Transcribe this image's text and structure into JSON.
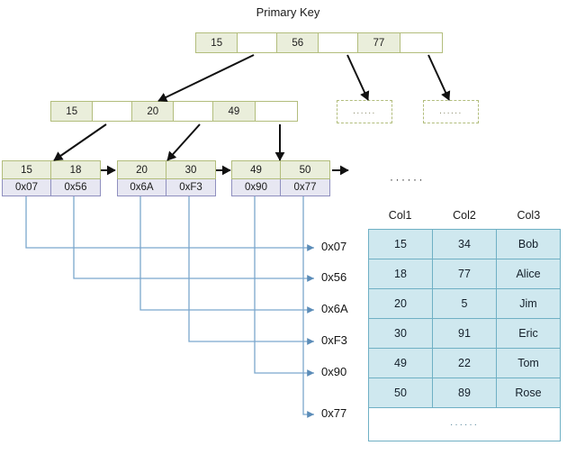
{
  "title": "Primary Key",
  "colors": {
    "index_node_fill": "#eaeedb",
    "index_node_border": "#b2bd7c",
    "pointer_row_fill": "#e7e7f2",
    "pointer_row_border": "#8f8fbf",
    "table_fill": "#cfe8ef",
    "table_border": "#6fb0c4",
    "connector_line": "#7ba7cd",
    "tree_arrow": "#111111"
  },
  "tree": {
    "root": {
      "name": "root-node",
      "cells": [
        {
          "label": "15",
          "empty": false
        },
        {
          "label": "",
          "empty": true
        },
        {
          "label": "56",
          "empty": false
        },
        {
          "label": "",
          "empty": true
        },
        {
          "label": "77",
          "empty": false
        },
        {
          "label": "",
          "empty": true
        }
      ]
    },
    "internal": {
      "name": "internal-node",
      "cells": [
        {
          "label": "15",
          "empty": false
        },
        {
          "label": "",
          "empty": true
        },
        {
          "label": "20",
          "empty": false
        },
        {
          "label": "",
          "empty": true
        },
        {
          "label": "49",
          "empty": false
        },
        {
          "label": "",
          "empty": true
        }
      ]
    },
    "leaves": [
      {
        "name": "leaf-node-1",
        "keys": [
          "15",
          "18"
        ],
        "pointers": [
          "0x07",
          "0x56"
        ]
      },
      {
        "name": "leaf-node-2",
        "keys": [
          "20",
          "30"
        ],
        "pointers": [
          "0x6A",
          "0xF3"
        ]
      },
      {
        "name": "leaf-node-3",
        "keys": [
          "49",
          "50"
        ],
        "pointers": [
          "0x90",
          "0x77"
        ]
      }
    ],
    "placeholders": [
      {
        "name": "placeholder-node-1",
        "label": "......"
      },
      {
        "name": "placeholder-node-2",
        "label": "......"
      }
    ]
  },
  "addresses": [
    {
      "label": "0x07"
    },
    {
      "label": "0x56"
    },
    {
      "label": "0x6A"
    },
    {
      "label": "0xF3"
    },
    {
      "label": "0x90"
    },
    {
      "label": "0x77"
    }
  ],
  "data_table": {
    "above_ellipsis": "······",
    "columns": [
      "Col1",
      "Col2",
      "Col3"
    ],
    "rows": [
      [
        "15",
        "34",
        "Bob"
      ],
      [
        "18",
        "77",
        "Alice"
      ],
      [
        "20",
        "5",
        "Jim"
      ],
      [
        "30",
        "91",
        "Eric"
      ],
      [
        "49",
        "22",
        "Tom"
      ],
      [
        "50",
        "89",
        "Rose"
      ]
    ],
    "trailing_ellipsis": "······"
  }
}
